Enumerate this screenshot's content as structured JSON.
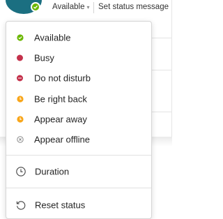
{
  "colors": {
    "available": "#6bb700",
    "busy": "#c4314b",
    "do_not_disturb": "#c4314b",
    "away": "#f8a61a",
    "offline": "#8a8a8a",
    "avatar_ring": "#1b6f81"
  },
  "header": {
    "status_label": "Available",
    "set_status_message": "Set status message"
  },
  "menu": {
    "statuses": [
      {
        "label": "Available",
        "icon": "available-dot-icon"
      },
      {
        "label": "Busy",
        "icon": "busy-dot-icon"
      },
      {
        "label": "Do not disturb",
        "icon": "do-not-disturb-icon"
      },
      {
        "label": "Be right back",
        "icon": "clock-badge-icon"
      },
      {
        "label": "Appear away",
        "icon": "clock-badge-icon"
      },
      {
        "label": "Appear offline",
        "icon": "offline-x-icon"
      }
    ],
    "duration_label": "Duration",
    "duration_icon": "clock-icon",
    "reset_label": "Reset status",
    "reset_icon": "reset-icon"
  }
}
